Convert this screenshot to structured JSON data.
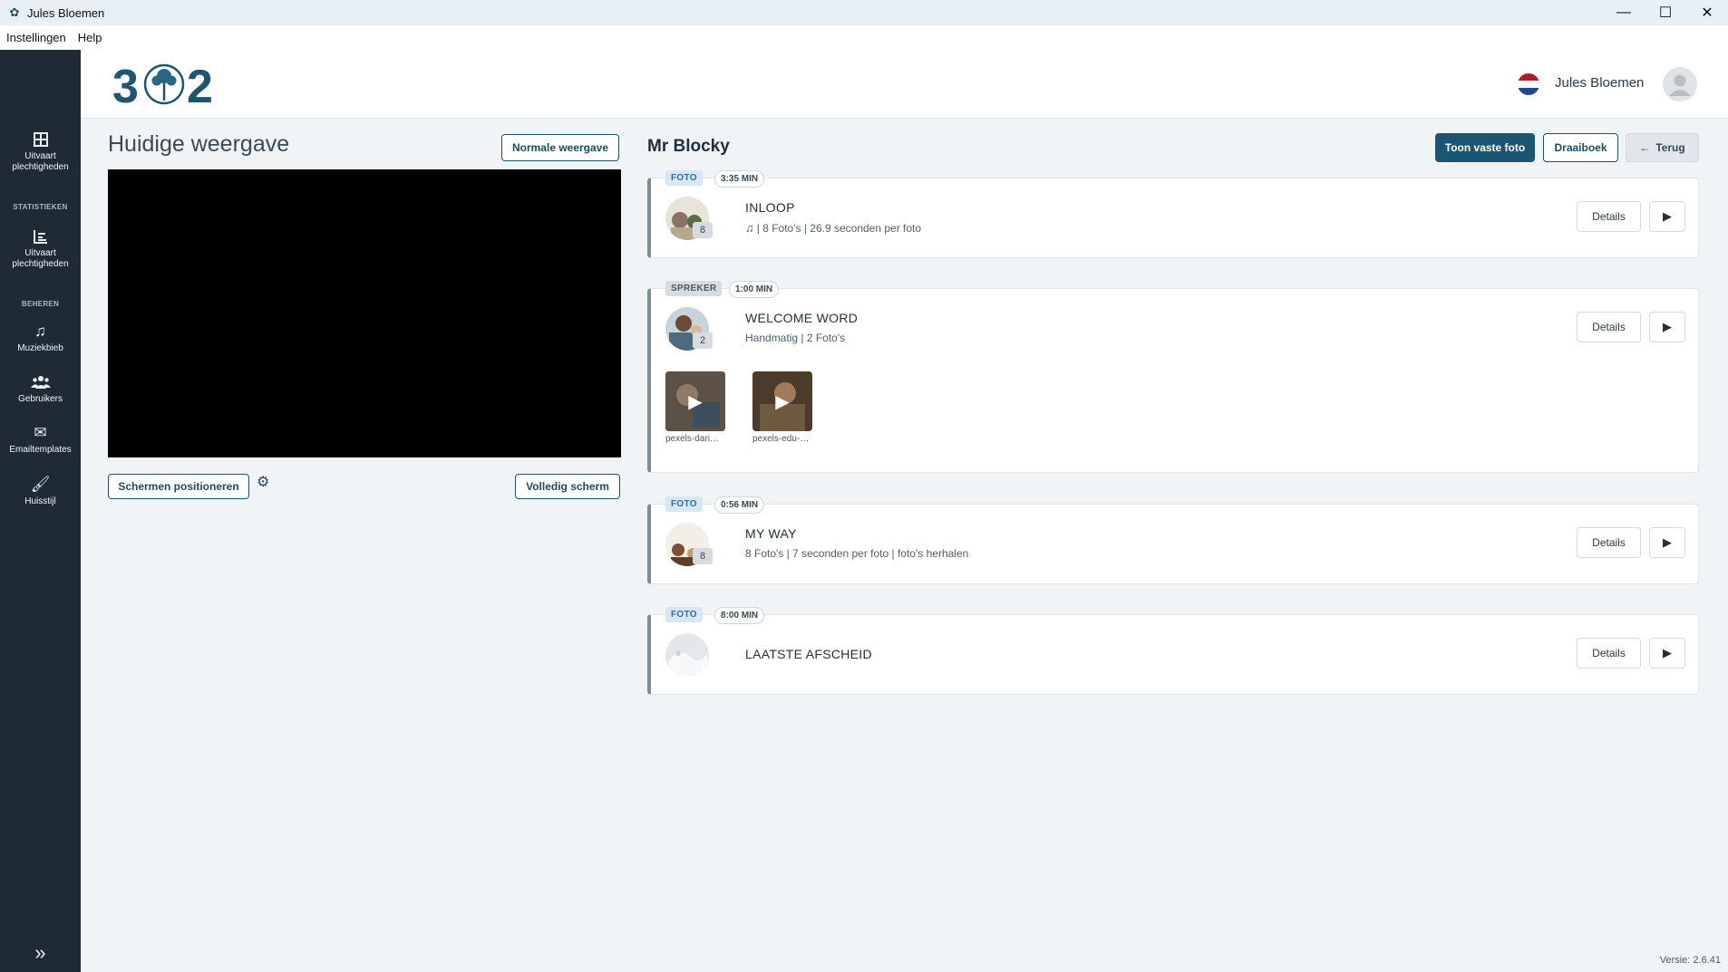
{
  "window": {
    "title": "Jules Bloemen"
  },
  "menubar": {
    "items": [
      "Instellingen",
      "Help"
    ]
  },
  "sidebar": {
    "items": [
      {
        "label": "Uitvaart plechtigheden",
        "icon": "grid-icon"
      },
      {
        "label": "Uitvaart plechtigheden",
        "icon": "bar-chart-icon"
      },
      {
        "label": "Muziekbieb",
        "icon": "music-icon"
      },
      {
        "label": "Gebruikers",
        "icon": "users-icon"
      },
      {
        "label": "Emailtemplates",
        "icon": "envelope-icon"
      },
      {
        "label": "Huisstijl",
        "icon": "brush-icon"
      }
    ],
    "sections": [
      "STATISTIEKEN",
      "BEHEREN"
    ]
  },
  "header": {
    "user_name": "Jules Bloemen",
    "flag": "NL"
  },
  "left": {
    "title": "Huidige weergave",
    "normal_view_label": "Normale weergave",
    "position_screens_label": "Schermen positioneren",
    "fullscreen_label": "Volledig scherm"
  },
  "right": {
    "title": "Mr Blocky",
    "show_photo_label": "Toon vaste foto",
    "script_label": "Draaiboek",
    "back_label": "Terug"
  },
  "cards": [
    {
      "type": "FOTO",
      "time": "3:35 MIN",
      "title": "INLOOP",
      "subtitle": "| 8 Foto's | 26.9 seconden per foto",
      "count": "8",
      "details": "Details"
    },
    {
      "type": "SPREKER",
      "time": "1:00 MIN",
      "title": "WELCOME WORD",
      "subtitle": "Handmatig | 2 Foto's",
      "count": "2",
      "details": "Details",
      "media": [
        {
          "caption": "pexels-dari…"
        },
        {
          "caption": "pexels-edu-…"
        }
      ]
    },
    {
      "type": "FOTO",
      "time": "0:56 MIN",
      "title": "MY WAY",
      "subtitle": "8 Foto's | 7 seconden per foto | foto's herhalen",
      "count": "8",
      "details": "Details"
    },
    {
      "type": "FOTO",
      "time": "8:00 MIN",
      "title": "LAATSTE AFSCHEID",
      "details": "Details"
    }
  ],
  "footer": {
    "version": "Versie: 2.6.41"
  }
}
